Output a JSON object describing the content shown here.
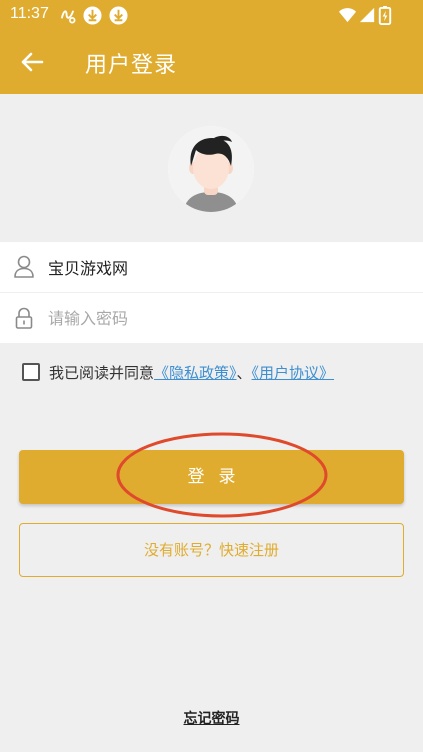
{
  "status_bar": {
    "time": "11:37",
    "icons": [
      "gesture-icon",
      "download-icon",
      "download-icon",
      "wifi-icon",
      "signal-icon",
      "battery-icon"
    ]
  },
  "header": {
    "title": "用户登录",
    "back_icon": "arrow-left-icon",
    "background_color": "#e0ac2f"
  },
  "form": {
    "username": {
      "icon": "user-icon",
      "value": "宝贝游戏网"
    },
    "password": {
      "icon": "lock-icon",
      "placeholder": "请输入密码"
    },
    "agreement": {
      "checked": false,
      "prefix": "我已阅读并同意",
      "privacy_link": "《隐私政策》",
      "separator": "、",
      "terms_link": "《用户协议》"
    }
  },
  "actions": {
    "login_label": "登录",
    "register_label": "没有账号？快速注册",
    "forgot_label": "忘记密码"
  },
  "colors": {
    "accent": "#e0ac2f",
    "link": "#3d8fd1",
    "annotation": "#e04a2c"
  }
}
